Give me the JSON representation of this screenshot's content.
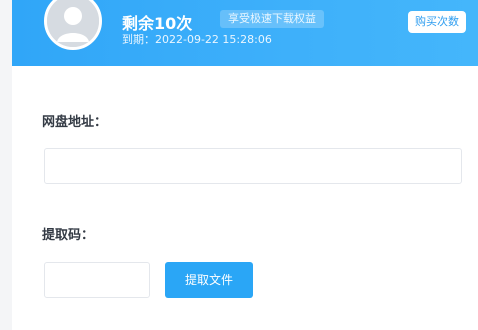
{
  "header": {
    "remaining": "剩余10次",
    "benefit_badge": "享受极速下载权益",
    "expiry": "到期：2022-09-22 15:28:06",
    "buy_button": "购买次数"
  },
  "form": {
    "url_label": "网盘地址：",
    "url_value": "",
    "code_label": "提取码：",
    "code_value": "",
    "submit_button": "提取文件"
  },
  "colors": {
    "header": "#3eb0fa",
    "button": "#2aa6f6"
  },
  "icons": {
    "avatar": "user-avatar-icon"
  }
}
